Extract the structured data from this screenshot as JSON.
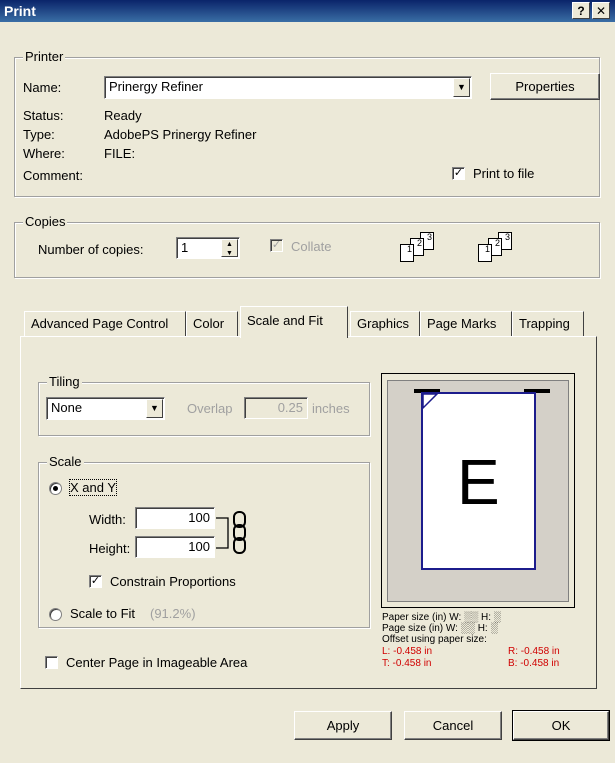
{
  "window": {
    "title": "Print",
    "help_label": "?",
    "close_label": "✕"
  },
  "printer": {
    "group_label": "Printer",
    "name_label": "Name:",
    "name_value": "Prinergy Refiner",
    "properties_label": "Properties",
    "status_label": "Status:",
    "status_value": "Ready",
    "type_label": "Type:",
    "type_value": "AdobePS Prinergy Refiner",
    "where_label": "Where:",
    "where_value": "FILE:",
    "comment_label": "Comment:",
    "comment_value": "",
    "print_to_file_label": "Print to file",
    "print_to_file_checked": true
  },
  "copies": {
    "group_label": "Copies",
    "number_label": "Number of copies:",
    "number_value": "1",
    "collate_label": "Collate",
    "collate_checked": true,
    "collate_enabled": false,
    "collate_pages": [
      "1",
      "2",
      "3"
    ]
  },
  "tabs": [
    {
      "label": "Advanced Page Control",
      "active": false
    },
    {
      "label": "Color",
      "active": false
    },
    {
      "label": "Scale and Fit",
      "active": true
    },
    {
      "label": "Graphics",
      "active": false
    },
    {
      "label": "Page Marks",
      "active": false
    },
    {
      "label": "Trapping",
      "active": false
    }
  ],
  "tiling": {
    "group_label": "Tiling",
    "mode_value": "None",
    "overlap_label": "Overlap",
    "overlap_value": "0.25",
    "overlap_unit": "inches"
  },
  "scale": {
    "group_label": "Scale",
    "xy_label": "X and Y",
    "xy_selected": true,
    "width_label": "Width:",
    "width_value": "100",
    "height_label": "Height:",
    "height_value": "100",
    "constrain_label": "Constrain Proportions",
    "constrain_checked": true,
    "fit_label": "Scale to Fit",
    "fit_value": "(91.2%)",
    "fit_selected": false
  },
  "center_page": {
    "label": "Center Page in Imageable Area",
    "checked": false
  },
  "preview": {
    "letter": "E",
    "paper_size_label": "Paper size (in) W:",
    "page_size_label": "Page size (in) W:",
    "height_label": "H:",
    "offset_label": "Offset using paper size:",
    "offset_left": "L: -0.458 in",
    "offset_right": "R: -0.458 in",
    "offset_top": "T: -0.458 in",
    "offset_bottom": "B: -0.458 in"
  },
  "buttons": {
    "apply": "Apply",
    "cancel": "Cancel",
    "ok": "OK"
  },
  "colors": {
    "titlebar": "#0a246a",
    "face": "#ece9d8",
    "page_border": "#1c1c8c",
    "offset_text": "#d00000"
  },
  "icons": {
    "help": "question-mark-icon",
    "close": "close-icon",
    "dropdown": "chevron-down-icon",
    "spin": "spin-arrows-icon",
    "link": "chain-link-icon"
  }
}
